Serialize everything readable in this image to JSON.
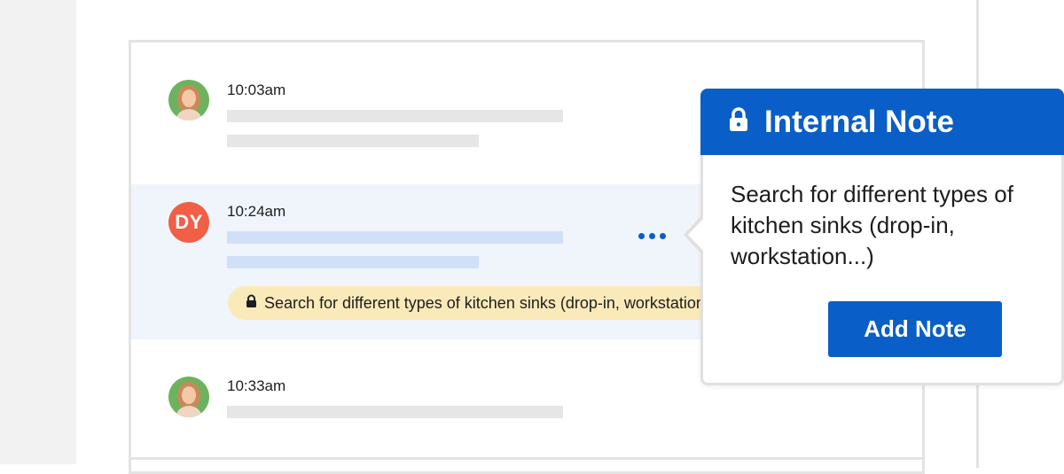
{
  "colors": {
    "accent": "#0a5ec7",
    "note_bg": "#fbeab9",
    "highlight_bg": "#f0f5fc",
    "initials_avatar": "#f05f46",
    "photo_avatar": "#6db35f"
  },
  "messages": [
    {
      "time": "10:03am",
      "avatar": "photo-avatar"
    },
    {
      "time": "10:24am",
      "avatar_initials": "DY",
      "highlighted": true,
      "note_text": "Search for different types of kitchen sinks (drop-in, workstation...)"
    },
    {
      "time": "10:33am",
      "avatar": "photo-avatar"
    }
  ],
  "message_actions_icon": "more-dots-icon",
  "popover": {
    "icon": "lock-icon",
    "title": "Internal Note",
    "body": "Search for different types of kitchen sinks (drop-in, workstation...)",
    "button_label": "Add Note"
  }
}
